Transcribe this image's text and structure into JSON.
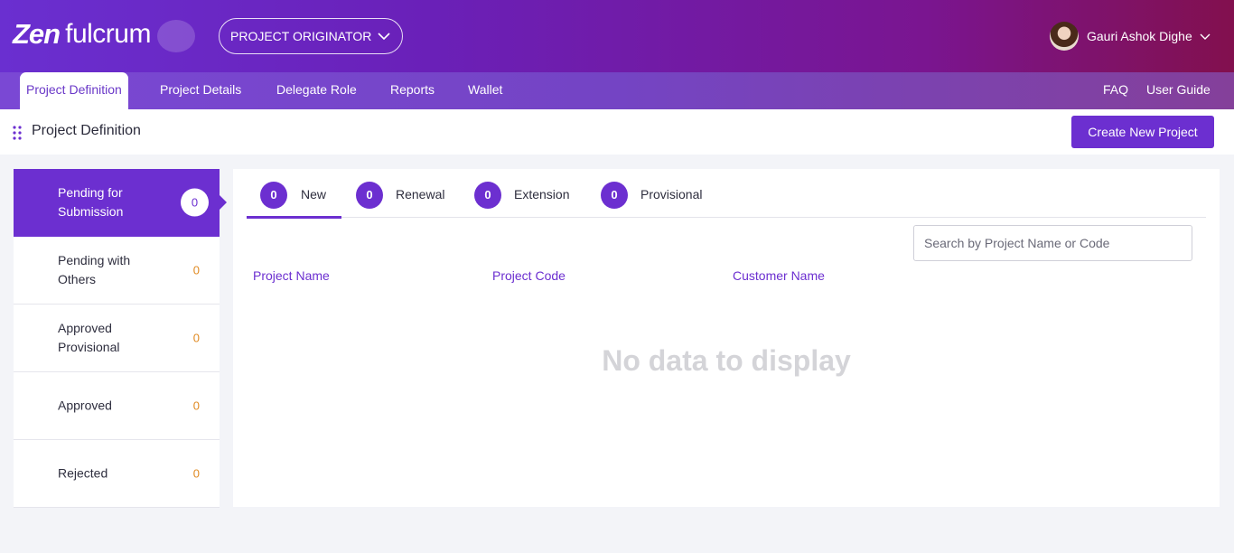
{
  "brand": {
    "logo_zen": "Zen",
    "logo_fulcrum": "fulcrum"
  },
  "header": {
    "role_selector": "PROJECT ORIGINATOR",
    "user_name": "Gauri Ashok Dighe"
  },
  "nav": {
    "tabs": [
      {
        "label": "Project Definition",
        "active": true
      },
      {
        "label": "Project Details"
      },
      {
        "label": "Delegate Role"
      },
      {
        "label": "Reports"
      },
      {
        "label": "Wallet"
      }
    ],
    "right": {
      "faq": "FAQ",
      "user_guide": "User Guide"
    }
  },
  "page": {
    "title": "Project Definition",
    "create_button": "Create New Project"
  },
  "sidebar": {
    "items": [
      {
        "label": "Pending for Submission",
        "count": "0",
        "active": true
      },
      {
        "label": "Pending with Others",
        "count": "0"
      },
      {
        "label": "Approved Provisional",
        "count": "0"
      },
      {
        "label": "Approved",
        "count": "0"
      },
      {
        "label": "Rejected",
        "count": "0"
      }
    ]
  },
  "main": {
    "tabs": [
      {
        "label": "New",
        "count": "0",
        "active": true
      },
      {
        "label": "Renewal",
        "count": "0"
      },
      {
        "label": "Extension",
        "count": "0"
      },
      {
        "label": "Provisional",
        "count": "0"
      }
    ],
    "search_placeholder": "Search by Project Name or Code",
    "columns": [
      "Project Name",
      "Project Code",
      "Customer Name"
    ],
    "empty_message": "No data to display"
  },
  "colors": {
    "accent": "#6c2fd0",
    "count_orange": "#e08a22"
  },
  "icons": {
    "role_chevron": "chevron-down-icon",
    "user_chevron": "chevron-down-icon",
    "drag": "drag-handle-icon"
  }
}
